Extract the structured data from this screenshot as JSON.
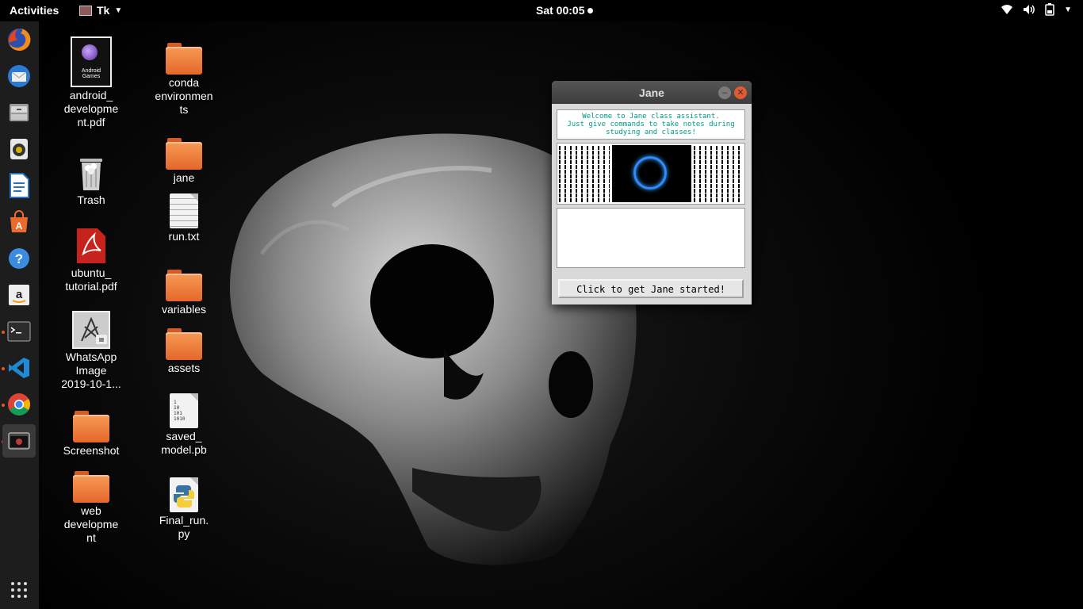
{
  "topbar": {
    "activities": "Activities",
    "app_menu": "Tk",
    "clock": "Sat 00:05"
  },
  "dock": {
    "items": [
      {
        "name": "firefox",
        "running": false
      },
      {
        "name": "thunderbird",
        "running": false
      },
      {
        "name": "files",
        "running": false
      },
      {
        "name": "rhythmbox",
        "running": false
      },
      {
        "name": "libreoffice-writer",
        "running": false
      },
      {
        "name": "software-center",
        "running": false
      },
      {
        "name": "help",
        "running": false
      },
      {
        "name": "amazon",
        "running": false
      },
      {
        "name": "terminal",
        "running": true
      },
      {
        "name": "vscode",
        "running": true
      },
      {
        "name": "chrome",
        "running": true
      },
      {
        "name": "tk-app",
        "running": true,
        "active": true
      }
    ]
  },
  "desktop": {
    "col1": [
      {
        "label": "android_\ndevelopme\nnt.pdf",
        "type": "pdf-cover"
      },
      {
        "label": "Trash",
        "type": "trash"
      },
      {
        "label": "ubuntu_\ntutorial.pdf",
        "type": "pdf"
      },
      {
        "label": "WhatsApp\nImage\n2019-10-1...",
        "type": "image"
      },
      {
        "label": "Screenshot",
        "type": "folder"
      },
      {
        "label": "web\ndevelopme\nnt",
        "type": "folder"
      }
    ],
    "col2": [
      {
        "label": "conda\nenvironmen\nts",
        "type": "folder"
      },
      {
        "label": "jane",
        "type": "folder"
      },
      {
        "label": "run.txt",
        "type": "text"
      },
      {
        "label": "variables",
        "type": "folder"
      },
      {
        "label": "assets",
        "type": "folder"
      },
      {
        "label": "saved_\nmodel.pb",
        "type": "binary"
      },
      {
        "label": "Final_run.\npy",
        "type": "python"
      }
    ],
    "pdf_cover_title": "Android Games",
    "binary_glyph": "1\n10\n101\n1010"
  },
  "window": {
    "title": "Jane",
    "welcome_text": "Welcome to Jane class assistant.\nJust give commands to take notes during\nstudying and classes!",
    "notes_text": "",
    "start_button": "Click to get Jane started!"
  },
  "colors": {
    "accent": "#e95420",
    "welcome_text": "#009a86",
    "ring": "#2f8bff"
  }
}
